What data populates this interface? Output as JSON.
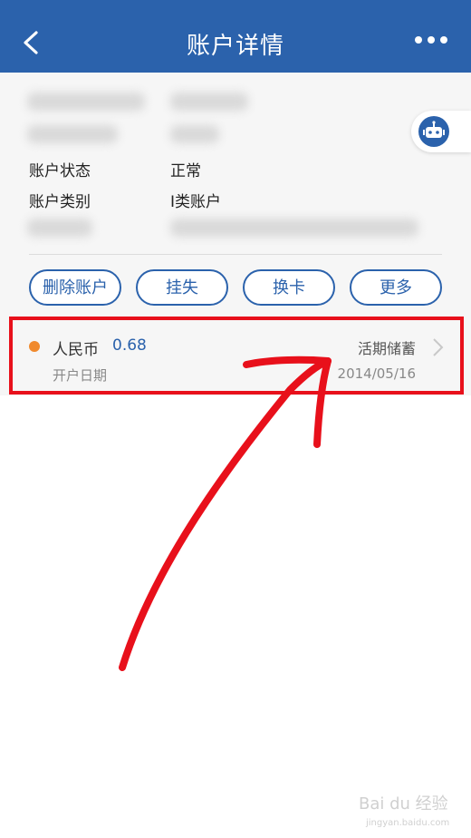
{
  "header": {
    "title": "账户详情"
  },
  "details": {
    "status_label": "账户状态",
    "status_value": "正常",
    "category_label": "账户类别",
    "category_value": "I类账户"
  },
  "actions": {
    "delete": "删除账户",
    "report_loss": "挂失",
    "change_card": "换卡",
    "more": "更多"
  },
  "account": {
    "currency": "人民币",
    "balance": "0.68",
    "type": "活期储蓄",
    "open_label": "开户日期",
    "open_date": "2014/05/16"
  },
  "watermark": {
    "text": "Bai du 经验",
    "url": "jingyan.baidu.com"
  },
  "colors": {
    "header": "#2b62ac",
    "accent": "#2b62ac",
    "dot": "#f08a2e",
    "annotation": "#e8101b"
  }
}
